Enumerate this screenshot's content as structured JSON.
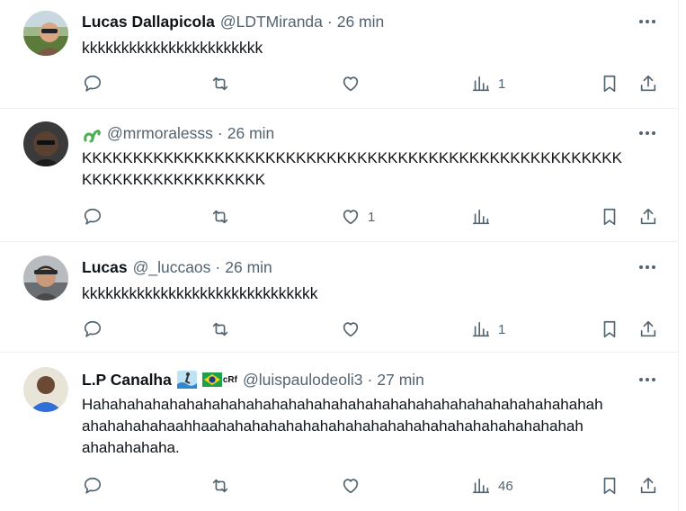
{
  "tweets": [
    {
      "name": "Lucas Dallapicola",
      "handle": "@LDTMiranda",
      "time": "26 min",
      "text": "kkkkkkkkkkkkkkkkkkkkkkk",
      "likes": "",
      "views": "1",
      "avatar": "man-sunglasses-outdoor"
    },
    {
      "name": "",
      "handle": "@mrmoralesss",
      "time": "26 min",
      "text": "KKKKKKKKKKKKKKKKKKKKKKKKKKKKKKKKKKKKKKKKKKKKKKKKKKKKK\nKKKKKKKKKKKKKKKKKK",
      "likes": "1",
      "views": "",
      "avatar": "man-dark-glasses",
      "name_icon": "green-snake-icon"
    },
    {
      "name": "Lucas",
      "handle": "@_luccaos",
      "time": "26 min",
      "text": "kkkkkkkkkkkkkkkkkkkkkkkkkkkkkk",
      "likes": "",
      "views": "1",
      "avatar": "man-cap-car"
    },
    {
      "name": "L.P Canalha",
      "handle": "@luispaulodeoli3",
      "time": "27 min",
      "text": "Hahahahahahahahahahahahahahahahahahahahahahahahahahahahahahah\nahahahahahaahhaahahahahahahahahahahahahahahahahahahahahahah\nahahahahaha.",
      "likes": "",
      "views": "46",
      "avatar": "man-blue-shirt",
      "name_suffix": "cRf",
      "name_emojis": [
        "surfer-emoji",
        "brazil-flag-emoji"
      ]
    }
  ],
  "dot_separator": "·",
  "colors": {
    "text": "#0f1419",
    "secondary": "#536471",
    "divider": "#eff3f4",
    "snake": "#4caf50"
  }
}
